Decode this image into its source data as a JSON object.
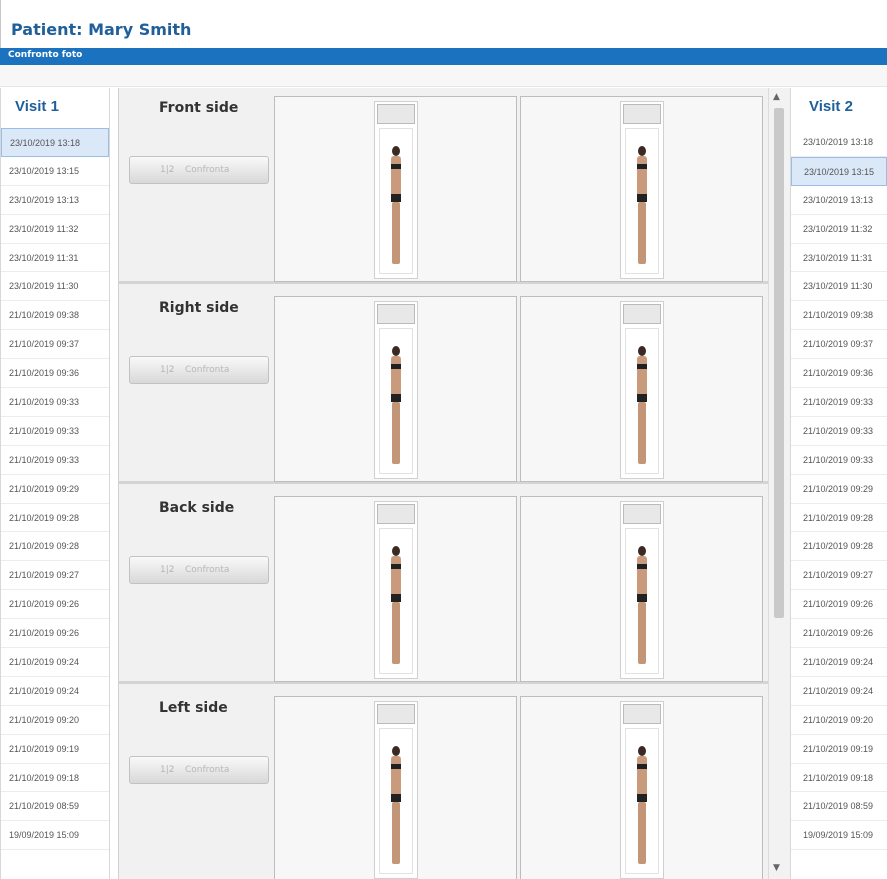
{
  "header": {
    "patient_title": "Patient: Mary Smith"
  },
  "bluebar": {
    "label": "Confronto foto"
  },
  "visit1": {
    "title": "Visit 1",
    "dates": [
      "23/10/2019 13:18",
      "23/10/2019 13:15",
      "23/10/2019 13:13",
      "23/10/2019 11:32",
      "23/10/2019 11:31",
      "23/10/2019 11:30",
      "21/10/2019 09:38",
      "21/10/2019 09:37",
      "21/10/2019 09:36",
      "21/10/2019 09:33",
      "21/10/2019 09:33",
      "21/10/2019 09:33",
      "21/10/2019 09:29",
      "21/10/2019 09:28",
      "21/10/2019 09:28",
      "21/10/2019 09:27",
      "21/10/2019 09:26",
      "21/10/2019 09:26",
      "21/10/2019 09:24",
      "21/10/2019 09:24",
      "21/10/2019 09:20",
      "21/10/2019 09:19",
      "21/10/2019 09:18",
      "21/10/2019 08:59",
      "19/09/2019 15:09"
    ],
    "selected_index": 0
  },
  "visit2": {
    "title": "Visit 2",
    "dates": [
      "23/10/2019 13:18",
      "23/10/2019 13:15",
      "23/10/2019 13:13",
      "23/10/2019 11:32",
      "23/10/2019 11:31",
      "23/10/2019 11:30",
      "21/10/2019 09:38",
      "21/10/2019 09:37",
      "21/10/2019 09:36",
      "21/10/2019 09:33",
      "21/10/2019 09:33",
      "21/10/2019 09:33",
      "21/10/2019 09:29",
      "21/10/2019 09:28",
      "21/10/2019 09:28",
      "21/10/2019 09:27",
      "21/10/2019 09:26",
      "21/10/2019 09:26",
      "21/10/2019 09:24",
      "21/10/2019 09:24",
      "21/10/2019 09:20",
      "21/10/2019 09:19",
      "21/10/2019 09:18",
      "21/10/2019 08:59",
      "19/09/2019 15:09"
    ],
    "selected_index": 1
  },
  "sides": [
    {
      "label": "Front side",
      "button_icon": "1|2",
      "button_label": "Confronta"
    },
    {
      "label": "Right side",
      "button_icon": "1|2",
      "button_label": "Confronta"
    },
    {
      "label": "Back side",
      "button_icon": "1|2",
      "button_label": "Confronta"
    },
    {
      "label": "Left side",
      "button_icon": "1|2",
      "button_label": "Confronta"
    }
  ],
  "scrollbar": {
    "up_icon": "▲",
    "down_icon": "▼"
  },
  "colors": {
    "accent": "#1b72bf",
    "title_text": "#1f5f9a"
  }
}
